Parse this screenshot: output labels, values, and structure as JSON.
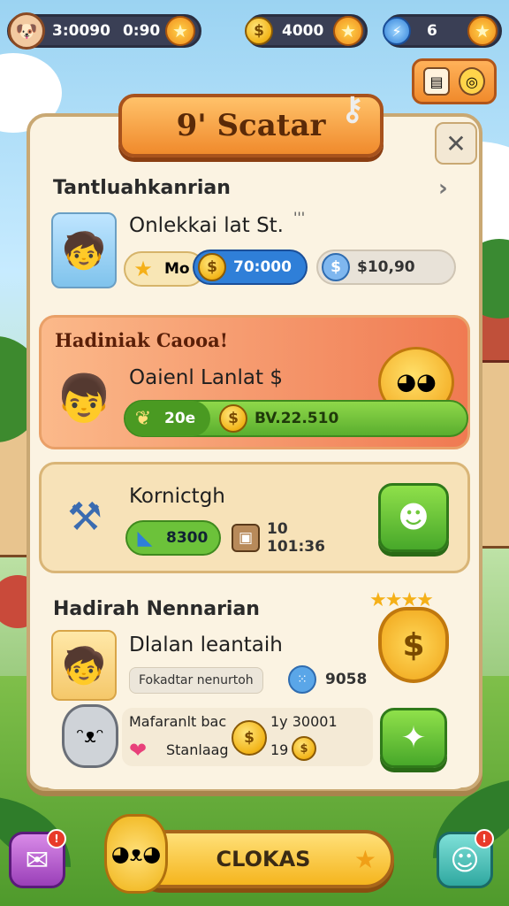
{
  "top_bar": {
    "left_value": "3:0090",
    "timer": "0:90",
    "coins": "4000",
    "gems": "6"
  },
  "panel": {
    "title": "9' Scatar"
  },
  "section1": {
    "title": "Tantluahkanrian",
    "item_title": "Onlekkai lat St.",
    "item_dots": "'''",
    "chip_star": "Mo",
    "chip_coin": "70:000",
    "chip_money": "$10,90"
  },
  "section2": {
    "title": "Hadiniak Caooa!",
    "item_title": "Oaienl Lanlat $",
    "chip_leaf": "20e",
    "chip_coin": "BV.22.510"
  },
  "section3": {
    "item_title": "Kornictgh",
    "chip_boot": "8300",
    "chip_box": "10 101:36"
  },
  "section4": {
    "title": "Hadirah Nennarian",
    "item_title": "Dlalan leantaih",
    "tag": "Fokadtar nenurtoh",
    "count": "9058",
    "sub_line1": "Mafaranlt bac",
    "sub_line2": "Stanlaag",
    "sub_amount1": "1y 30001",
    "sub_amount2": "19"
  },
  "bottom": {
    "main_button": "CLOKAS"
  },
  "icons": {
    "star": "★",
    "coin": "$",
    "close": "✕"
  },
  "colors": {
    "orange": "#f08a2c",
    "green": "#48a82a",
    "panel": "#fbf3e2",
    "coin": "#f2b418"
  }
}
